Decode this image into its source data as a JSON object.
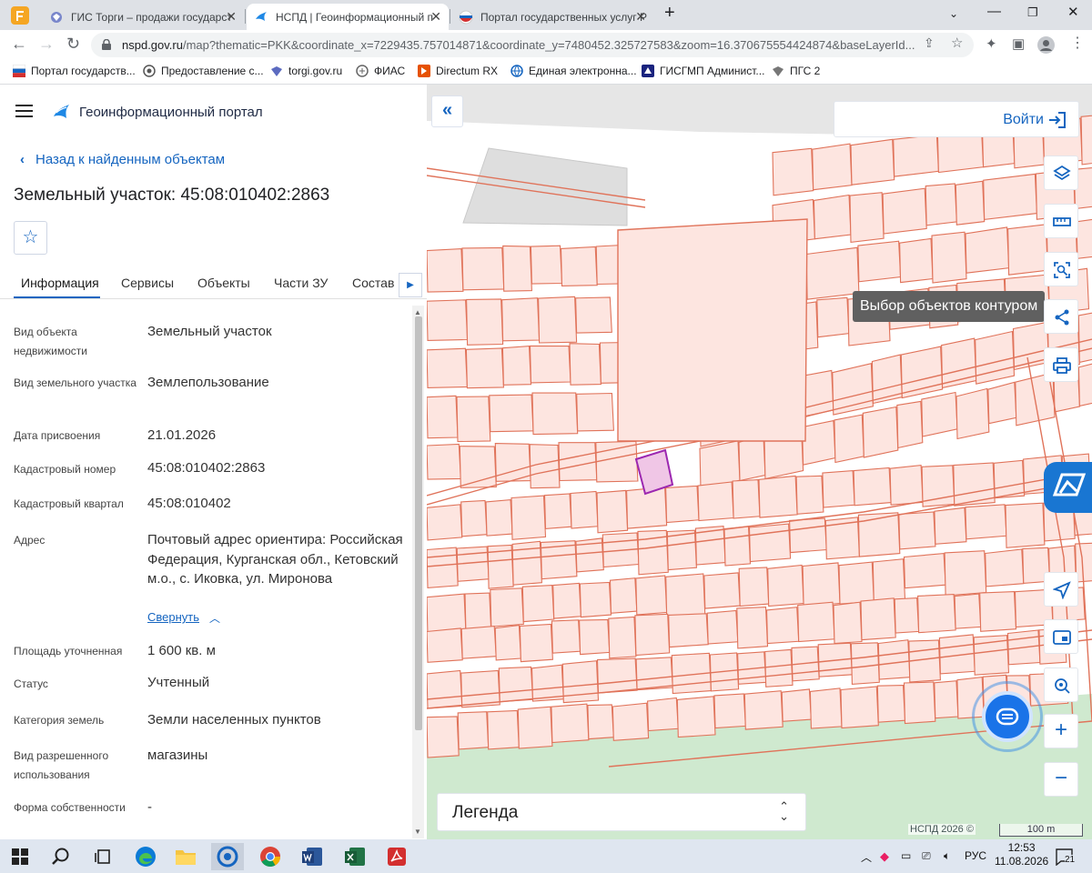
{
  "browser": {
    "tabs": [
      {
        "title": "ГИС Торги – продажи государст"
      },
      {
        "title": "НСПД | Геоинформационный п"
      },
      {
        "title": "Портал государственных услуг Р"
      }
    ],
    "url_host": "nspd.gov.ru",
    "url_rest": "/map?thematic=PKK&coordinate_x=7229435.757014871&coordinate_y=7480452.325727583&zoom=16.370675554424874&baseLayerId...",
    "bookmarks": [
      {
        "label": "Портал государств...",
        "color": "#d32f2f"
      },
      {
        "label": "Предоставление с...",
        "color": "#555555"
      },
      {
        "label": "torgi.gov.ru",
        "color": "#3f51b5"
      },
      {
        "label": "ФИАС",
        "color": "#555555"
      },
      {
        "label": "Directum RX",
        "color": "#e65100"
      },
      {
        "label": "Единая электронна...",
        "color": "#1565c0"
      },
      {
        "label": "ГИСГМП Админист...",
        "color": "#1a237e"
      },
      {
        "label": "ПГС 2",
        "color": "#555555"
      }
    ]
  },
  "portal": {
    "title": "Геоинформационный портал",
    "back_label": "Назад к найденным объектам",
    "object_title": "Земельный участок: 45:08:010402:2863",
    "tabs": [
      "Информация",
      "Сервисы",
      "Объекты",
      "Части ЗУ",
      "Состав"
    ],
    "fields": [
      {
        "label": "Вид объекта недвижимости",
        "value": "Земельный участок"
      },
      {
        "label": "Вид земельного участка",
        "value": "Землепользование"
      },
      {
        "label": "Дата присвоения",
        "value": "21.01.2026"
      },
      {
        "label": "Кадастровый номер",
        "value": "45:08:010402:2863"
      },
      {
        "label": "Кадастровый квартал",
        "value": "45:08:010402"
      },
      {
        "label": "Адрес",
        "value": "Почтовый адрес ориентира: Российская Федерация, Курганская обл., Кетовский м.о., с. Иковка, ул. Миронова"
      },
      {
        "label": "Площадь уточненная",
        "value": "1 600 кв. м"
      },
      {
        "label": "Статус",
        "value": "Учтенный"
      },
      {
        "label": "Категория земель",
        "value": "Земли населенных пунктов"
      },
      {
        "label": "Вид разрешенного использования",
        "value": "магазины"
      },
      {
        "label": "Форма собственности",
        "value": "-"
      }
    ],
    "collapse_label": "Свернуть"
  },
  "map": {
    "login_label": "Войти",
    "tooltip": "Выбор объектов контуром",
    "legend_label": "Легенда",
    "copyright": "НСПД 2026 ©",
    "scale_label": "100 m",
    "parcel_stroke": "#e0735a",
    "parcel_fill": "#fde5e0",
    "selected_stroke": "#9c27b0",
    "selected_fill": "#f0c6e6"
  },
  "taskbar": {
    "lang": "РУС",
    "time": "12:53",
    "date": "11.08.2026",
    "notif_count": "21"
  }
}
